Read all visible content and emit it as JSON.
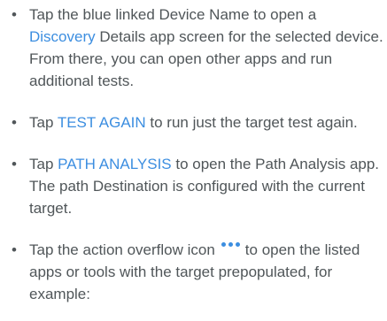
{
  "bullets": {
    "symbol": "•"
  },
  "items": [
    {
      "text_1": "Tap the blue linked Device Name to open a ",
      "link": "Discovery",
      "text_2": " Details app screen for the selected device. From there, you can open other apps and run additional tests."
    },
    {
      "text_1": "Tap ",
      "link": "TEST AGAIN",
      "text_2": " to run just the target test again."
    },
    {
      "text_1": "Tap ",
      "link": "PATH ANALYSIS",
      "text_2": " to open the Path Analysis app. The path Destination is con­figured with the current target."
    },
    {
      "text_1": "Tap the action overflow icon",
      "icon": "more-horizontal-icon",
      "text_2": "to open the listed apps or tools with the target pre­populated, for example:"
    }
  ],
  "colors": {
    "text": "#505659",
    "link": "#3c8ee0"
  }
}
